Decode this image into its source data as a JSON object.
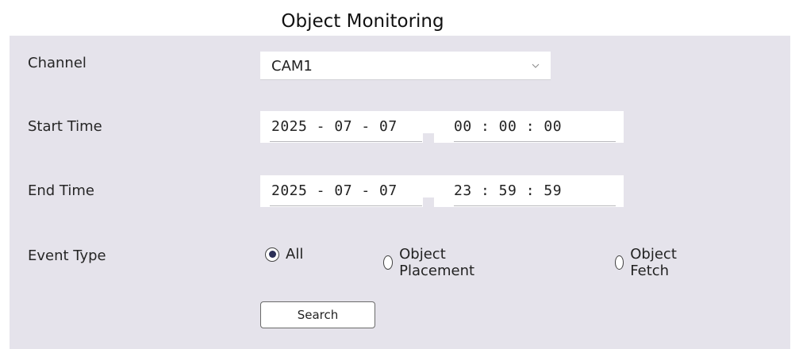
{
  "title": "Object Monitoring",
  "form": {
    "channel": {
      "label": "Channel",
      "value": "CAM1",
      "icon": "chevron-down-icon"
    },
    "start_time": {
      "label": "Start Time",
      "date": "2025 - 07 - 07",
      "time": "00 : 00 : 00"
    },
    "end_time": {
      "label": "End Time",
      "date": "2025 - 07 - 07",
      "time": "23 : 59 : 59"
    },
    "event_type": {
      "label": "Event Type",
      "options": [
        {
          "label": "All",
          "selected": true
        },
        {
          "label": "Object Placement",
          "selected": false
        },
        {
          "label": "Object Fetch",
          "selected": false
        }
      ]
    },
    "search_label": "Search"
  },
  "colors": {
    "panel_bg": "#e5e3eb",
    "radio_dot": "#2b2f57"
  }
}
